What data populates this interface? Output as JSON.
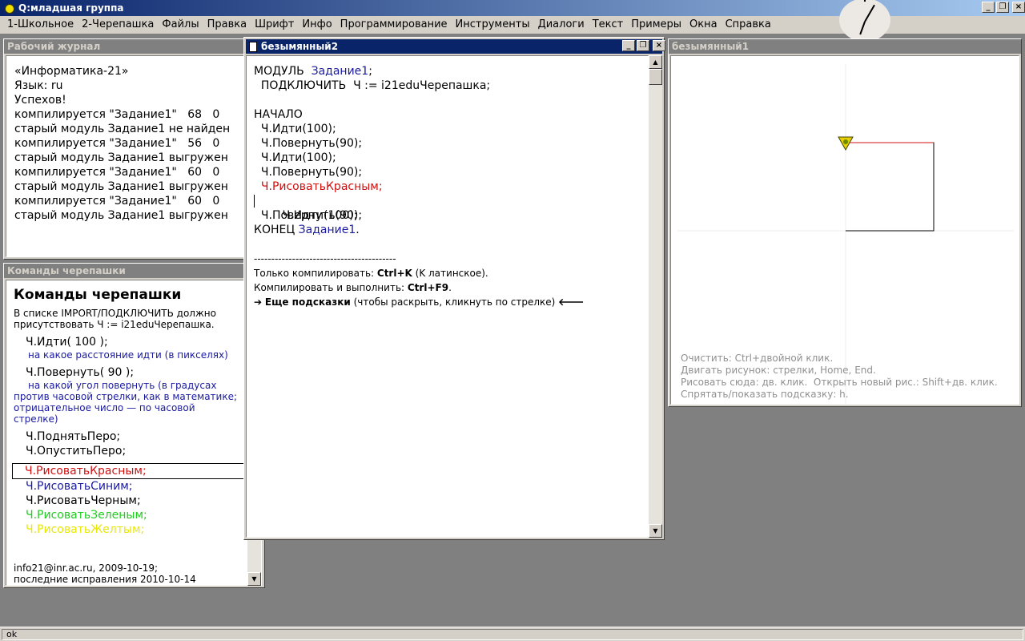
{
  "app": {
    "title": "Q:младшая группа",
    "minimize_glyph": "_",
    "restore_glyph": "❐",
    "close_glyph": "×"
  },
  "menu": [
    "1-Школьное",
    "2-Черепашка",
    "Файлы",
    "Правка",
    "Шрифт",
    "Инфо",
    "Программирование",
    "Инструменты",
    "Диалоги",
    "Текст",
    "Примеры",
    "Окна",
    "Справка"
  ],
  "journal": {
    "title": "Рабочий журнал",
    "lines": [
      "«Информатика-21»",
      "Язык: ru",
      "Успехов!",
      "компилируется \"Задание1\"   68   0",
      "старый модуль Задание1 не найден",
      "компилируется \"Задание1\"   56   0",
      "старый модуль Задание1 выгружен",
      "компилируется \"Задание1\"   60   0",
      "старый модуль Задание1 выгружен",
      "компилируется \"Задание1\"   60   0",
      "старый модуль Задание1 выгружен"
    ]
  },
  "commands": {
    "title": "Команды черепашки",
    "heading": "Команды черепашки",
    "intro_1": "В списке IMPORT/ПОДКЛЮЧИТЬ должно",
    "intro_2": "присутствовать  Ч := i21eduЧерепашка.",
    "go": "Ч.Идти( 100 );",
    "go_note": "на какое расстояние идти (в пикселях)",
    "turn": "Ч.Повернуть( 90 );",
    "turn_note_1": "на какой угол повернуть (в градусах",
    "turn_note_2": "против часовой стрелки, как в математике;",
    "turn_note_3": "отрицательное число — по часовой",
    "turn_note_4": "стрелке)",
    "pen_up": "Ч.ПоднятьПеро;",
    "pen_down": "Ч.ОпуститьПеро;",
    "draw_red": "Ч.РисоватьКрасным;",
    "draw_blue": "Ч.РисоватьСиним;",
    "draw_black": "Ч.РисоватьЧерным;",
    "draw_green": "Ч.РисоватьЗеленым;",
    "draw_yellow": "Ч.РисоватьЖелтым;",
    "footer_1": "info21@inr.ac.ru, 2009-10-19;",
    "footer_2": "последние исправления 2010-10-14"
  },
  "editor": {
    "title": "безымянный2",
    "module_kw": "МОДУЛЬ",
    "module_name": "Задание1",
    "semicolon": ";",
    "import_line": "  ПОДКЛЮЧИТЬ  Ч := i21eduЧерепашка;",
    "begin_kw": "НАЧАЛО",
    "body": [
      "  Ч.Идти(100);",
      "  Ч.Повернуть(90);",
      "  Ч.Идти(100);",
      "  Ч.Повернуть(90);"
    ],
    "red_line": "  Ч.РисоватьКрасным;",
    "body2": [
      "  Ч.Идти(100);",
      "  Ч.Повернуть(90);"
    ],
    "end_kw": "КОНЕЦ",
    "end_name": "Задание1",
    "period": ".",
    "separator": "-----------------------------------------",
    "hint1_pre": "Только компилировать: ",
    "hint1_key": "Ctrl+K",
    "hint1_post": " (K латинское).",
    "hint2_pre": "Компилировать и выполнить: ",
    "hint2_key": "Ctrl+F9",
    "hint2_post": ".",
    "more_arrow": "➔",
    "more_bold": "Еще подсказки",
    "more_post": " (чтобы раскрыть, кликнуть по стрелке) ",
    "more_back": "🡐"
  },
  "canvas": {
    "title": "безымянный1",
    "hints": [
      "Очистить: Ctrl+двойной клик.",
      "Двигать рисунок: стрелки, Home, End.",
      "Рисовать сюда: дв. клик.  Открыть новый рис.: Shift+дв. клик.",
      "Спрятать/показать подсказку: h."
    ]
  },
  "status": {
    "text": "ok"
  },
  "colors": {
    "red": "#d01010",
    "blue": "#1a1aa0",
    "green": "#22cc22",
    "yellow": "#e8e800"
  }
}
